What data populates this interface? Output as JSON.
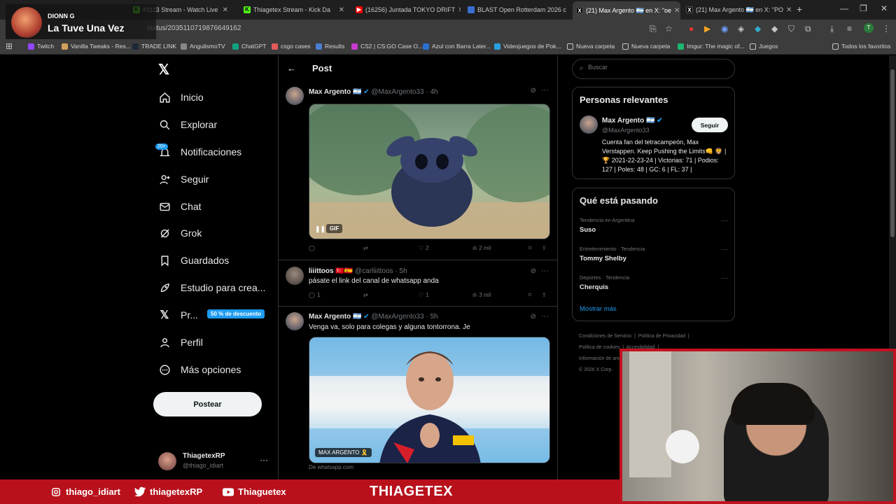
{
  "stream_overlay": {
    "artist": "DIONN G",
    "song": "La Tuve Una Vez"
  },
  "browser": {
    "tabs": [
      {
        "label": "#1113 Stream - Watch Live",
        "icon": "kick-icon"
      },
      {
        "label": "Thiagetex Stream - Kick Da",
        "icon": "kick-icon"
      },
      {
        "label": "(16256) Juntada TOKYO DRIFT",
        "icon": "youtube-icon"
      },
      {
        "label": "BLAST Open Rotterdam 2026 c",
        "icon": "page-icon"
      },
      {
        "label": "(21) Max Argento 🇦🇷 en X: \"oe",
        "icon": "x-icon",
        "active": true
      },
      {
        "label": "(21) Max Argento 🇦🇷 en X: \"PO",
        "icon": "x-icon"
      }
    ],
    "url": "status/2035110719876649162",
    "bookmarks": [
      {
        "label": "Twitch",
        "color": "#9146ff"
      },
      {
        "label": "Vanilla Tweaks - Res...",
        "color": "#d1a05a"
      },
      {
        "label": "TRADE LINK",
        "color": "#1b2838"
      },
      {
        "label": "AngulismoTV",
        "color": "#888888"
      },
      {
        "label": "ChatGPT",
        "color": "#10a37f"
      },
      {
        "label": "csgo cases",
        "color": "#e05a5a"
      },
      {
        "label": "Results",
        "color": "#4a7fd1"
      },
      {
        "label": "CS2 | CS:GO Case O...",
        "color": "#c73ad0"
      },
      {
        "label": "Azul con Barra Later...",
        "color": "#2b6fd1"
      },
      {
        "label": "Videojuegos de Pok...",
        "color": "#2aa0e0"
      },
      {
        "label": "Nueva carpeta",
        "color": "#c4c7c5"
      },
      {
        "label": "Nueva carpeta",
        "color": "#c4c7c5"
      },
      {
        "label": "Imgur: The magic of...",
        "color": "#1bb76e"
      },
      {
        "label": "Juegos",
        "color": "#c4c7c5"
      },
      {
        "label": "Todos los favoritos",
        "color": "#c4c7c5"
      }
    ]
  },
  "sidebar": {
    "items": [
      {
        "label": "Inicio",
        "icon": "home-icon"
      },
      {
        "label": "Explorar",
        "icon": "search-icon"
      },
      {
        "label": "Notificaciones",
        "icon": "bell-icon"
      },
      {
        "label": "Seguir",
        "icon": "follow-icon"
      },
      {
        "label": "Chat",
        "icon": "mail-icon"
      },
      {
        "label": "Grok",
        "icon": "grok-icon"
      },
      {
        "label": "Guardados",
        "icon": "bookmark-icon"
      },
      {
        "label": "Estudio para crea...",
        "icon": "rocket-icon"
      },
      {
        "label": "Pr...",
        "icon": "x-premium-icon"
      },
      {
        "label": "Perfil",
        "icon": "profile-icon"
      },
      {
        "label": "Más opciones",
        "icon": "more-icon"
      }
    ],
    "notif_badge": "20+",
    "premium_pill": "50 % de descuento",
    "post_button": "Postear",
    "account": {
      "name": "ThiagetexRP",
      "handle": "@thiago_idiart"
    }
  },
  "main": {
    "header_title": "Post",
    "tweets": [
      {
        "name": "Max Argento 🇦🇷",
        "handle": "@MaxArgento33",
        "time": "· 4h",
        "media_label": "GIF",
        "replies": "",
        "reposts": "",
        "likes": "2",
        "views": "2 mil"
      },
      {
        "name": "liiittoos 🇹🇷🇪🇸",
        "handle": "@carliiittoos",
        "time": "· 5h",
        "text": "pásate el link del canal de whatsapp anda",
        "replies": "1",
        "reposts": "",
        "likes": "1",
        "views": "3 mil"
      },
      {
        "name": "Max Argento 🇦🇷",
        "handle": "@MaxArgento33",
        "time": "· 5h",
        "text": "Venga va, solo para colegas y alguna tontorrona. Je",
        "media_label": "MAX ARGENTO 🎗️",
        "source": "De whatsapp.com"
      }
    ]
  },
  "right": {
    "search_placeholder": "Buscar",
    "relevant": {
      "title": "Personas relevantes",
      "name": "Max Argento 🇦🇷",
      "handle": "@MaxArgento33",
      "follow": "Seguir",
      "bio": "Cuenta fan del tetracampeón, Max Verstappen. Keep Pushing the Limits👊 🦁 |🏆 2021-22-23-24 | Victorias: 71 | Podios: 127 | Poles: 48 | GC: 6 | FL: 37 |"
    },
    "trends": {
      "title": "Qué está pasando",
      "items": [
        {
          "meta": "Tendencia en Argentina",
          "name": "Suso"
        },
        {
          "meta": "Entretenimiento · Tendencia",
          "name": "Tommy Shelby"
        },
        {
          "meta": "Deportes · Tendencia",
          "name": "Cherquis"
        }
      ],
      "show_more": "Mostrar más"
    },
    "footer": [
      "Condiciones de Servicio",
      "Política de Privacidad",
      "Política de cookies",
      "Accesibilidad",
      "Información de anuncios",
      "© 2026 X Corp."
    ]
  },
  "bottom_bar": {
    "instagram": "thiago_idiart",
    "twitter": "thiagetexRP",
    "youtube": "Thiaguetex",
    "brand": "THIAGETEX",
    "color": "#b8111c"
  }
}
